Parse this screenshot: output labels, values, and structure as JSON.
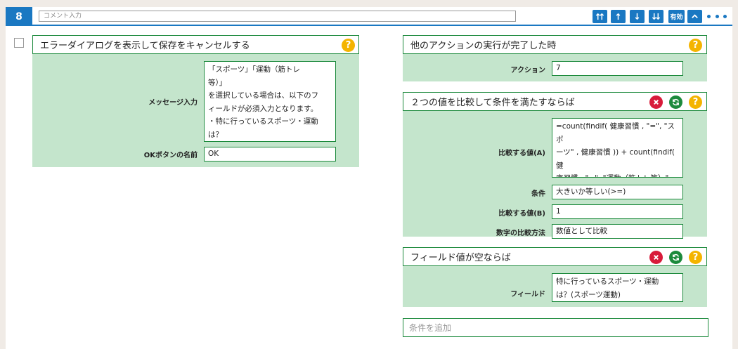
{
  "header": {
    "number": "8",
    "comment_placeholder": "コメント入力",
    "enabled_label": "有効"
  },
  "left": {
    "title": "エラーダイアログを表示して保存をキャンセルする",
    "message_label": "メッセージ入力",
    "message_value": "「スポーツ」「運動（筋トレ\n等）」\nを選択している場合は、以下のフ\nィールドが必須入力となります。\n・特に行っているスポーツ・運動\nは？",
    "ok_label": "OKボタンの名前",
    "ok_value": "OK"
  },
  "action_block": {
    "title": "他のアクションの実行が完了した時",
    "action_label": "アクション",
    "action_value": "7"
  },
  "compare_block": {
    "title": "２つの値を比較して条件を満たすならば",
    "value_a_label": "比較する値(A)",
    "value_a": "=count(findif( 健康習慣 , \"=\", \"スポ\nーツ\" , 健康習慣 )) + count(findif( 健\n康習慣 , \"=\", \"運動（筋トレ等）\" ,\n健康習慣 ))",
    "condition_label": "条件",
    "condition_value": "大きいか等しい(>=)",
    "value_b_label": "比較する値(B)",
    "value_b": "1",
    "method_label": "数字の比較方法",
    "method_value": "数値として比較"
  },
  "empty_block": {
    "title": "フィールド値が空ならば",
    "field_label": "フィールド",
    "field_value": "特に行っているスポーツ・運動\nは？(スポーツ運動)"
  },
  "add_condition_placeholder": "条件を追加",
  "colors": {
    "accent_blue": "#1a78c2",
    "green_border": "#1c8a3c",
    "green_bg": "#c4e5cc",
    "help_yellow": "#f4b400",
    "delete_red": "#d81b3a"
  }
}
